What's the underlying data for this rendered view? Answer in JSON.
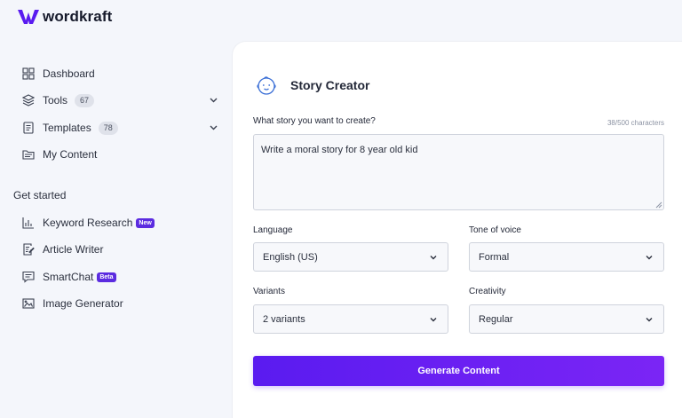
{
  "brand": {
    "name": "wordkraft",
    "color": "#5a1bf0"
  },
  "sidebar": {
    "items": [
      {
        "label": "Dashboard",
        "icon": "dashboard-grid-icon"
      },
      {
        "label": "Tools",
        "count": "67",
        "icon": "layers-icon",
        "expandable": true
      },
      {
        "label": "Templates",
        "count": "78",
        "icon": "document-icon",
        "expandable": true
      },
      {
        "label": "My Content",
        "icon": "folder-icon"
      }
    ],
    "section_title": "Get started",
    "get_started": [
      {
        "label": "Keyword Research",
        "badge": "New",
        "icon": "bar-chart-icon"
      },
      {
        "label": "Article Writer",
        "icon": "edit-document-icon"
      },
      {
        "label": "SmartChat",
        "badge": "Beta",
        "icon": "chat-icon"
      },
      {
        "label": "Image Generator",
        "icon": "image-icon"
      }
    ]
  },
  "panel": {
    "title": "Story Creator",
    "icon": "baby-face-icon",
    "prompt_label": "What story you want to create?",
    "char_count": "38/500 characters",
    "prompt_value": "Write a moral story for 8 year old kid",
    "language": {
      "label": "Language",
      "value": "English (US)"
    },
    "tone": {
      "label": "Tone of voice",
      "value": "Formal"
    },
    "variants": {
      "label": "Variants",
      "value": "2 variants"
    },
    "creativity": {
      "label": "Creativity",
      "value": "Regular"
    },
    "generate_label": "Generate Content"
  }
}
